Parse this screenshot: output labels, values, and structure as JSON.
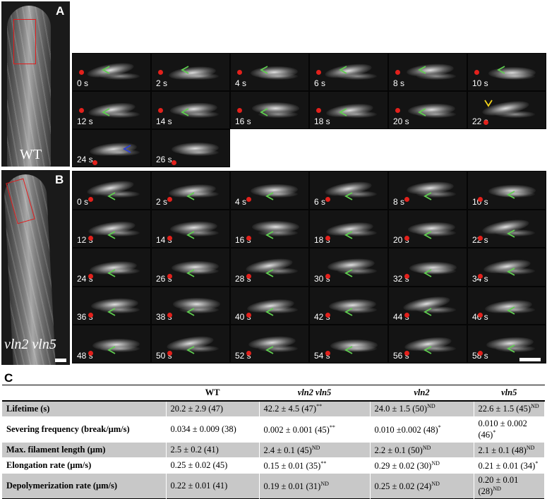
{
  "panel_a": {
    "letter": "A",
    "genotype": "WT",
    "frames": [
      "0 s",
      "2 s",
      "4 s",
      "6 s",
      "8 s",
      "10 s",
      "12 s",
      "14 s",
      "16 s",
      "18 s",
      "20 s",
      "22 s",
      "24 s",
      "26 s"
    ]
  },
  "panel_b": {
    "letter": "B",
    "genotype": "vln2 vln5",
    "frames": [
      "0 s",
      "2 s",
      "4 s",
      "6 s",
      "8 s",
      "10 s",
      "12 s",
      "14 s",
      "16 s",
      "18 s",
      "20 s",
      "22 s",
      "24 s",
      "26 s",
      "28 s",
      "30 s",
      "32 s",
      "34 s",
      "36 s",
      "38 s",
      "40 s",
      "42 s",
      "44 s",
      "46 s",
      "48 s",
      "50 s",
      "52 s",
      "54 s",
      "56 s",
      "58 s"
    ]
  },
  "panel_c": {
    "letter": "C",
    "columns": [
      "WT",
      "vln2 vln5",
      "vln2",
      "vln5"
    ],
    "rows": [
      {
        "label": "Lifetime (s)",
        "cells": [
          [
            "20.2 ± 2.9 (47)",
            ""
          ],
          [
            "42.2 ± 4.5 (47)",
            "**"
          ],
          [
            "24.0 ± 1.5 (50)",
            "ND"
          ],
          [
            "22.6 ± 1.5 (45)",
            "ND"
          ]
        ]
      },
      {
        "label": "Severing frequency (break/μm/s)",
        "cells": [
          [
            "0.034 ± 0.009 (38)",
            ""
          ],
          [
            "0.002 ± 0.001 (45)",
            "**"
          ],
          [
            "0.010 ±0.002 (48)",
            "*"
          ],
          [
            "0.010 ± 0.002 (46)",
            "*"
          ]
        ]
      },
      {
        "label": "Max. filament length (μm)",
        "cells": [
          [
            "2.5 ± 0.2 (41)",
            ""
          ],
          [
            "2.4 ± 0.1 (45)",
            "ND"
          ],
          [
            "2.2 ± 0.1 (50)",
            "ND"
          ],
          [
            "2.1 ± 0.1 (48)",
            "ND"
          ]
        ]
      },
      {
        "label": "Elongation rate (μm/s)",
        "cells": [
          [
            "0.25 ± 0.02 (45)",
            ""
          ],
          [
            "0.15 ± 0.01 (35)",
            "**"
          ],
          [
            "0.29 ± 0.02 (30)",
            "ND"
          ],
          [
            "0.21 ± 0.01 (34)",
            "*"
          ]
        ]
      },
      {
        "label": "Depolymerization rate (μm/s)",
        "cells": [
          [
            "0.22 ± 0.01 (41)",
            ""
          ],
          [
            "0.19 ± 0.01 (31)",
            "ND"
          ],
          [
            "0.25 ± 0.02 (24)",
            "ND"
          ],
          [
            "0.20 ± 0.01 (28)",
            "ND"
          ]
        ]
      }
    ]
  },
  "colors": {
    "marker_dot": "#e3211c",
    "arrow_green": "#5fcf4f",
    "arrow_yellow": "#f2d21b",
    "arrow_blue": "#2b3fd6",
    "roi": "#e11d1d"
  }
}
